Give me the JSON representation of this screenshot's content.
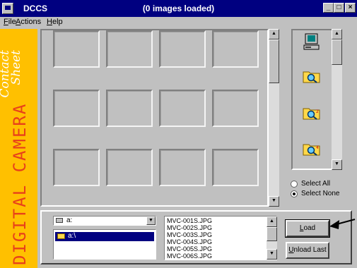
{
  "window": {
    "app_name": "DCCS",
    "title": "(0 images loaded)",
    "controls": {
      "minimize": "_",
      "maximize": "□",
      "close": "×"
    }
  },
  "menu": [
    {
      "mnemonic": "F",
      "rest": "ile"
    },
    {
      "mnemonic": "A",
      "rest": "ctions"
    },
    {
      "mnemonic": "H",
      "rest": "elp"
    }
  ],
  "banner": {
    "main_text": "DIGITAL CAMERA",
    "script_line1": "Contact",
    "script_line2": "Sheet",
    "background": "#ffc000",
    "main_color": "#e8401a",
    "script_color": "#ffffff"
  },
  "contact_sheet": {
    "rows": 3,
    "cols": 4
  },
  "icon_list": {
    "items": [
      "computer-icon",
      "search-folder-icon",
      "search-folder-2-icon",
      "search-folder-4-icon"
    ]
  },
  "selection": {
    "select_all": "Select All",
    "select_none": "Select None",
    "selected": "select_none"
  },
  "drive": {
    "value": "a:",
    "directory": "a:\\"
  },
  "files": [
    "MVC-001S.JPG",
    "MVC-002S.JPG",
    "MVC-003S.JPG",
    "MVC-004S.JPG",
    "MVC-005S.JPG",
    "MVC-006S.JPG"
  ],
  "buttons": {
    "load_mnemonic": "L",
    "load_rest": "oad",
    "unload_mnemonic": "U",
    "unload_rest": "nload Last"
  }
}
